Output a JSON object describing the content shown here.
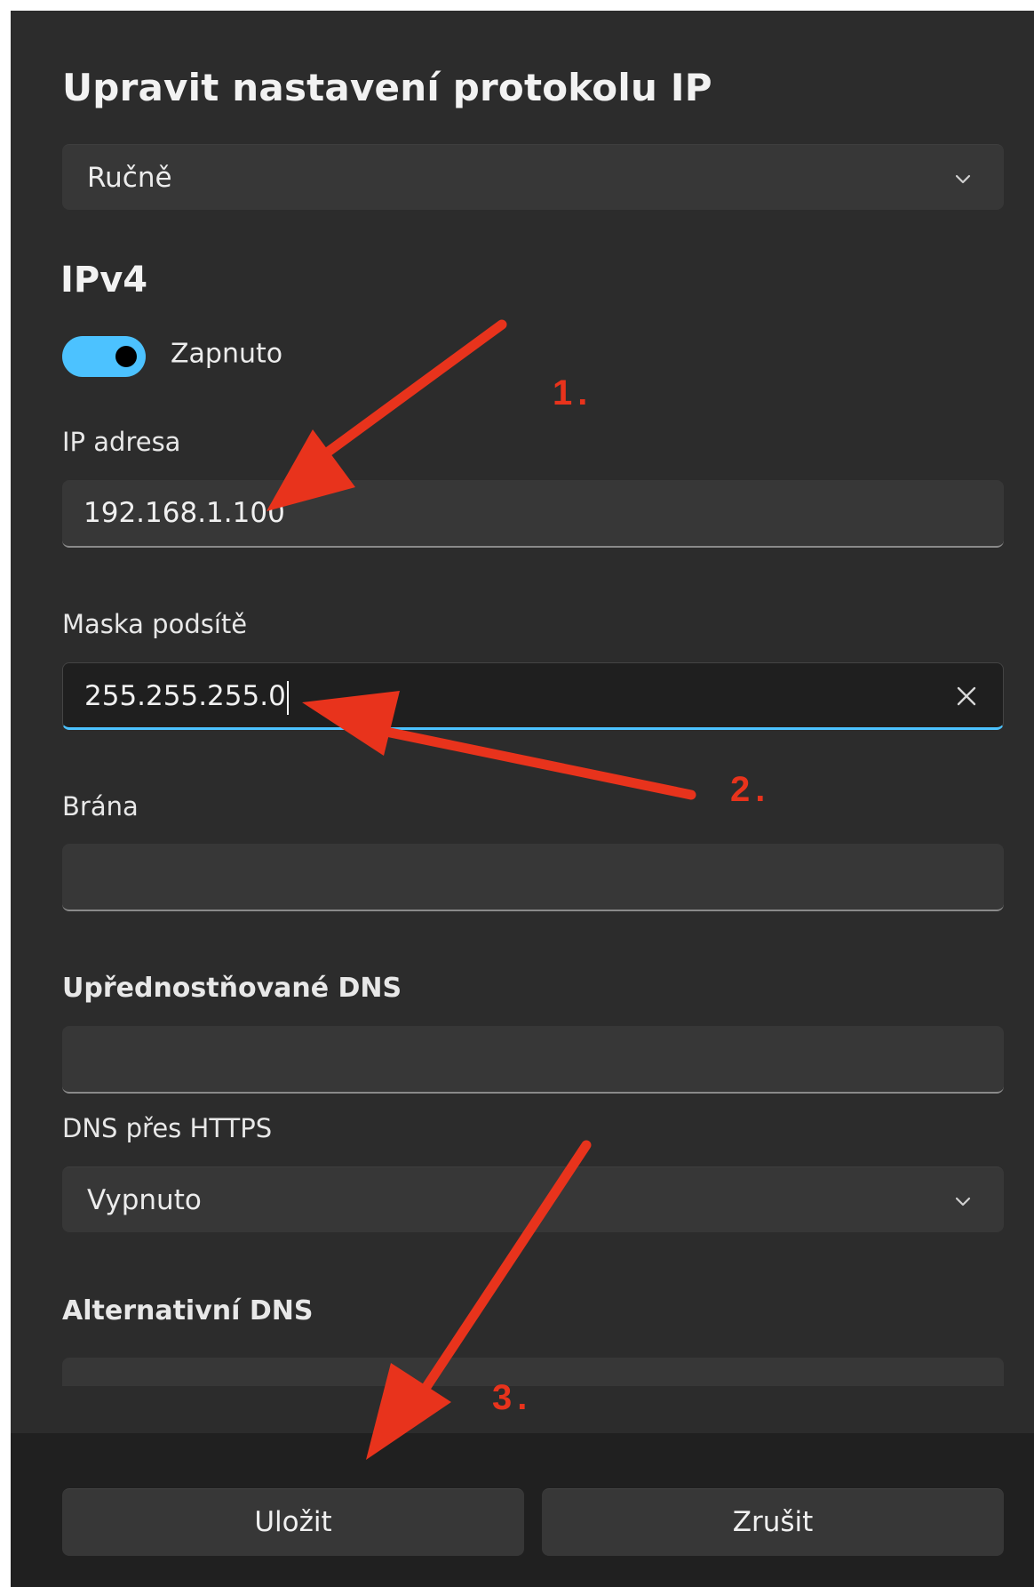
{
  "dialog": {
    "title": "Upravit nastavení protokolu IP",
    "mode_select": {
      "value": "Ručně",
      "icon": "chevron-down-icon"
    }
  },
  "ipv4": {
    "heading": "IPv4",
    "toggle": {
      "state": "on",
      "label": "Zapnuto",
      "accent": "#4cc2ff"
    },
    "ip_address": {
      "label": "IP adresa",
      "value": "192.168.1.100"
    },
    "subnet_mask": {
      "label": "Maska podsítě",
      "value": "255.255.255.0",
      "clear_icon": "close-icon"
    },
    "gateway": {
      "label": "Brána",
      "value": ""
    },
    "preferred_dns": {
      "label": "Upřednostňované DNS",
      "value": ""
    },
    "dns_over_https": {
      "label": "DNS přes HTTPS",
      "value": "Vypnuto",
      "icon": "chevron-down-icon"
    },
    "alternate_dns": {
      "label": "Alternativní DNS",
      "value": ""
    }
  },
  "footer": {
    "save_label": "Uložit",
    "cancel_label": "Zrušit"
  },
  "annotations": {
    "color": "#e8331c",
    "step1": "1.",
    "step2": "2.",
    "step3": "3."
  }
}
